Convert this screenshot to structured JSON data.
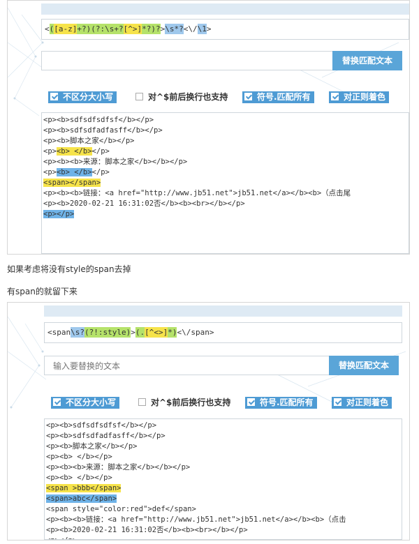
{
  "example1": {
    "regex_parts": [
      {
        "text": "<",
        "hl": ""
      },
      {
        "text": "(",
        "hl": "g"
      },
      {
        "text": "[a-z]",
        "hl": "y"
      },
      {
        "text": "+?)",
        "hl": "g"
      },
      {
        "text": "(?:",
        "hl": "g"
      },
      {
        "text": "\\s+?",
        "hl": "g"
      },
      {
        "text": "[^>]",
        "hl": "y"
      },
      {
        "text": "*?)?",
        "hl": "g"
      },
      {
        "text": ">",
        "hl": ""
      },
      {
        "text": "\\s*?",
        "hl": "b"
      },
      {
        "text": "<\\/",
        "hl": ""
      },
      {
        "text": "\\1",
        "hl": "b"
      },
      {
        "text": ">",
        "hl": ""
      }
    ],
    "replace_placeholder": "",
    "replace_button": "替换匹配文本",
    "options": [
      {
        "label": "不区分大小写",
        "checked": true
      },
      {
        "label": "对^$前后换行也支持",
        "checked": false
      },
      {
        "label": "符号.匹配所有",
        "checked": true
      },
      {
        "label": "对正则着色",
        "checked": true
      }
    ],
    "lines": [
      {
        "text": "<p><b>sdfsdfsdfsf</b></p>"
      },
      {
        "text": "<p><b>sdfsdfadfasff</b></p>"
      },
      {
        "text": "<p><b>脚本之家</b></p>"
      },
      {
        "pre": "<p>",
        "hl": "<b>  </b>",
        "hlc": "y",
        "post": "</p>"
      },
      {
        "text": "<p><b><b>来源：脚本之家</b></b></p>"
      },
      {
        "pre": "<p>",
        "hl": "<b>  </b>",
        "hlc": "b",
        "post": "</p>"
      },
      {
        "pre": "",
        "hl": "<span></span>",
        "hlc": "y",
        "post": ""
      },
      {
        "text": "<p><b><b>链接：<a href=\"http://www.jb51.net\">jb51.net</a></b><b>（点击尾"
      },
      {
        "text": "<p><b>2020-02-21 16:31:02否</b><b><br></b></p>"
      },
      {
        "pre": "",
        "hl": "<p></p>",
        "hlc": "b",
        "post": ""
      }
    ]
  },
  "caption1": "如果考虑将没有style的span去掉",
  "caption2": "有span的就留下来",
  "example2": {
    "regex_parts": [
      {
        "text": "<span",
        "hl": ""
      },
      {
        "text": "\\s?",
        "hl": "b"
      },
      {
        "text": "(?!",
        "hl": "g"
      },
      {
        "text": ":style)",
        "hl": "g"
      },
      {
        "text": ">",
        "hl": ""
      },
      {
        "text": "(.",
        "hl": "g"
      },
      {
        "text": "[^<>]",
        "hl": "y"
      },
      {
        "text": "*)",
        "hl": "g"
      },
      {
        "text": "<\\/span>",
        "hl": ""
      }
    ],
    "replace_placeholder": "输入要替换的文本",
    "replace_button": "替换匹配文本",
    "options": [
      {
        "label": "不区分大小写",
        "checked": true
      },
      {
        "label": "对^$前后换行也支持",
        "checked": false
      },
      {
        "label": "符号.匹配所有",
        "checked": true
      },
      {
        "label": "对正则着色",
        "checked": true
      }
    ],
    "lines": [
      {
        "text": "<p><b>sdfsdfsdfsf</b></p>"
      },
      {
        "text": "<p><b>sdfsdfadfasff</b></p>"
      },
      {
        "text": "<p><b>脚本之家</b></p>"
      },
      {
        "text": "<p><b> </b></p>"
      },
      {
        "text": "<p><b><b>来源：脚本之家</b></b></p>"
      },
      {
        "text": "<p><b> </b></p>"
      },
      {
        "pre": "",
        "hl": "<span >bbb</span>",
        "hlc": "y",
        "post": ""
      },
      {
        "pre": "",
        "hl": "<span>abc</span>",
        "hlc": "b",
        "post": ""
      },
      {
        "text": "<span style=\"color:red\">def</span>"
      },
      {
        "text": "<p><b><b>链接：<a href=\"http://www.jb51.net\">jb51.net</a></b><b>（点击"
      },
      {
        "text": "<p><b>2020-02-21 16:31:02否</b><b><br></b></p>"
      },
      {
        "text": "<p></p>"
      }
    ]
  }
}
